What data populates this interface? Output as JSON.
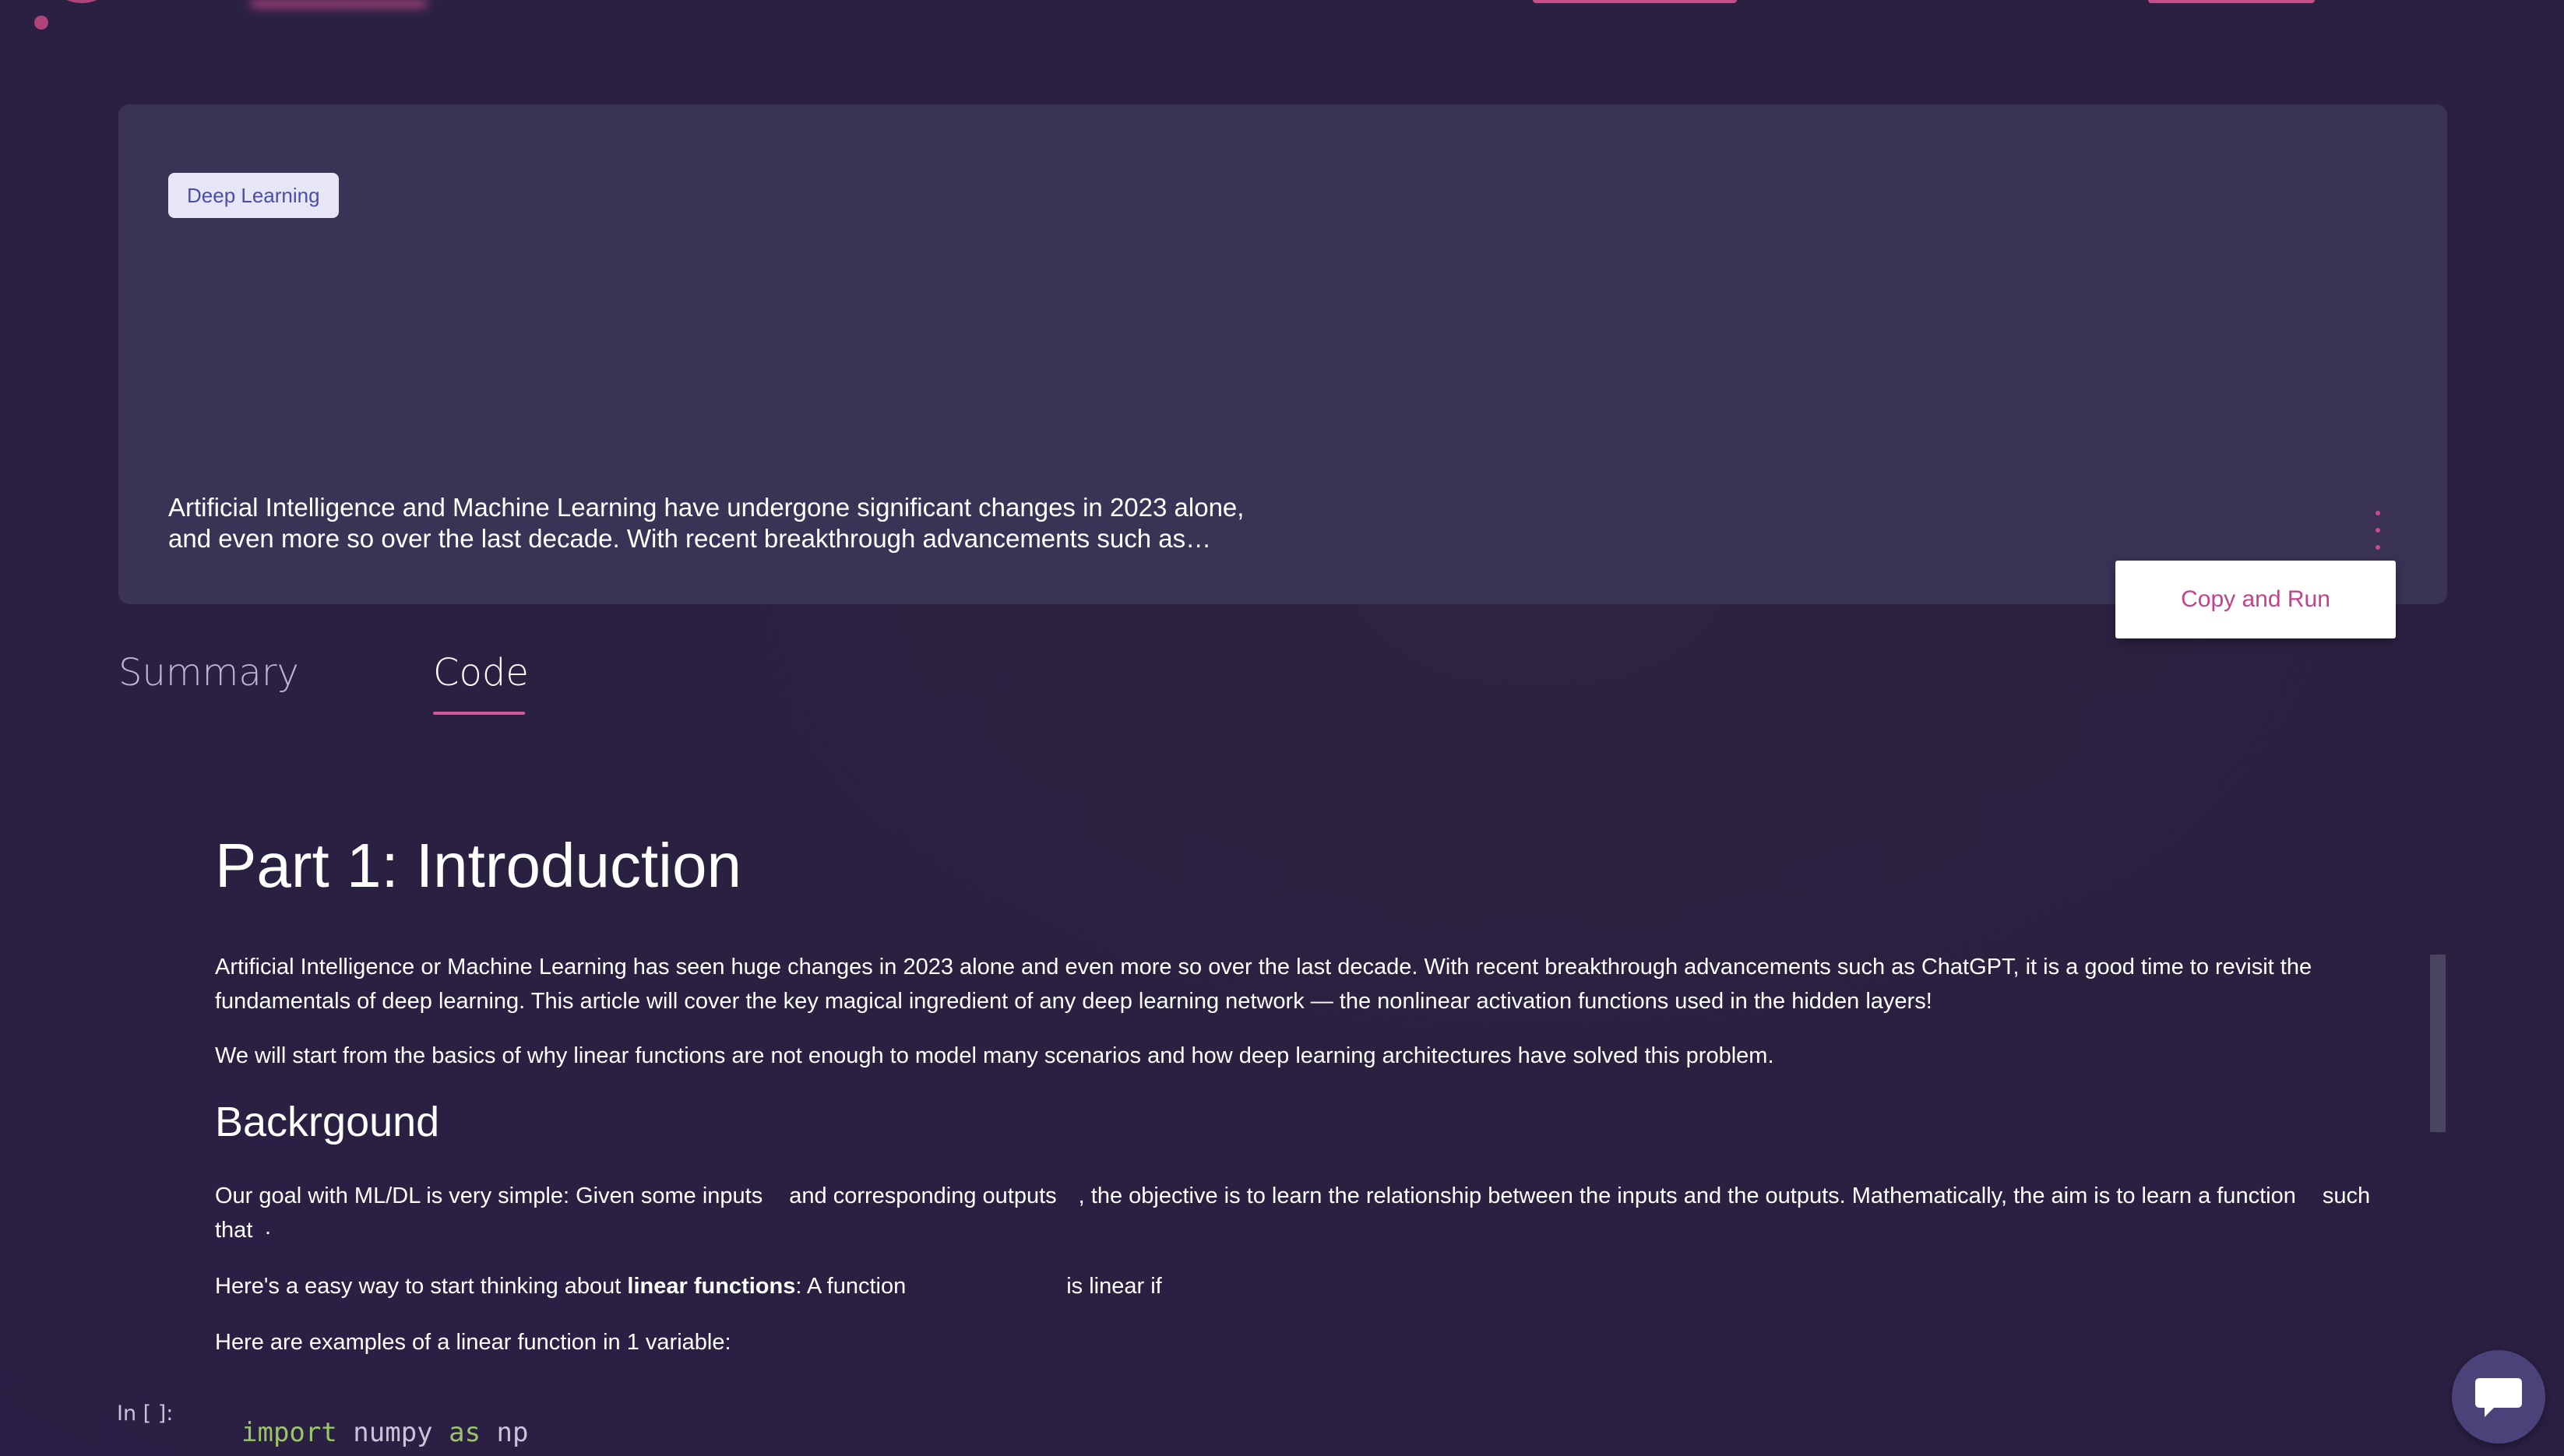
{
  "hero": {
    "tag": "Deep Learning",
    "description_line1": "Artificial Intelligence and Machine Learning have undergone significant changes in 2023 alone,",
    "description_line2": "and even more so over the last decade. With recent breakthrough advancements such as…",
    "copy_run_label": "Copy and Run"
  },
  "tabs": {
    "summary": "Summary",
    "code": "Code",
    "active": "Code"
  },
  "notebook": {
    "heading1": "Part 1: Introduction",
    "para1": "Artificial Intelligence or Machine Learning has seen huge changes in 2023 alone and even more so over the last decade. With recent breakthrough advancements such as ChatGPT, it is a good time to revisit the fundamentals of deep learning. This article will cover the key magical ingredient of any deep learning network — the nonlinear activation functions used in the hidden layers!",
    "para2": "We will start from the basics of why linear functions are not enough to model many scenarios and how deep learning architectures have solved this problem.",
    "heading2": "Backrgound",
    "para3_a": "Our goal with ML/DL is very simple: Given some inputs",
    "para3_b": "and corresponding outputs",
    "para3_c": ", the objective is to learn the relationship between the inputs and the outputs. Mathematically, the aim is to learn a function",
    "para3_d": "such that",
    "para3_end": ".",
    "para4_a": "Here's a easy way to start thinking about ",
    "para4_bold": "linear functions",
    "para4_b": ": A function",
    "para4_c": "is linear if",
    "para5": "Here are examples of a linear function in 1 variable:",
    "cell_label": "In [ ]:",
    "code_kw1": "import",
    "code_mod": " numpy ",
    "code_kw2": "as",
    "code_alias": " np"
  },
  "colors": {
    "accent": "#c84b8a",
    "card": "#3b3355",
    "background": "#2a2142"
  },
  "icons": {
    "more": "kebab-menu-icon",
    "chat": "chat-bubble-icon"
  }
}
